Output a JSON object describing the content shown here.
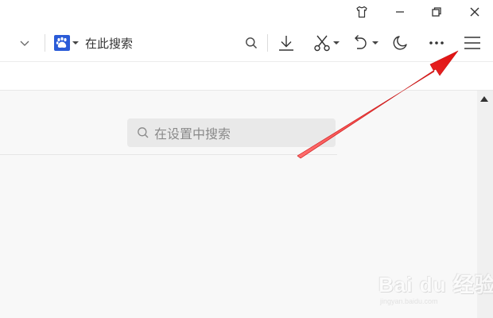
{
  "toolbar": {
    "search_placeholder": "在此搜索",
    "icons": [
      "chevron-down-icon",
      "baidu-paw-icon",
      "search-icon",
      "download-icon",
      "scissors-icon",
      "undo-icon",
      "moon-icon",
      "more-icon",
      "menu-icon"
    ]
  },
  "window": {
    "icons": [
      "shirt-icon",
      "minimize-icon",
      "restore-icon",
      "close-icon"
    ]
  },
  "settings": {
    "search_placeholder": "在设置中搜索"
  },
  "watermark": {
    "main_text": "Bai du 经验",
    "sub_text": "jingyan.baidu.com"
  },
  "colors": {
    "accent_blue": "#2a5bd7",
    "arrow_red": "#e02020"
  }
}
